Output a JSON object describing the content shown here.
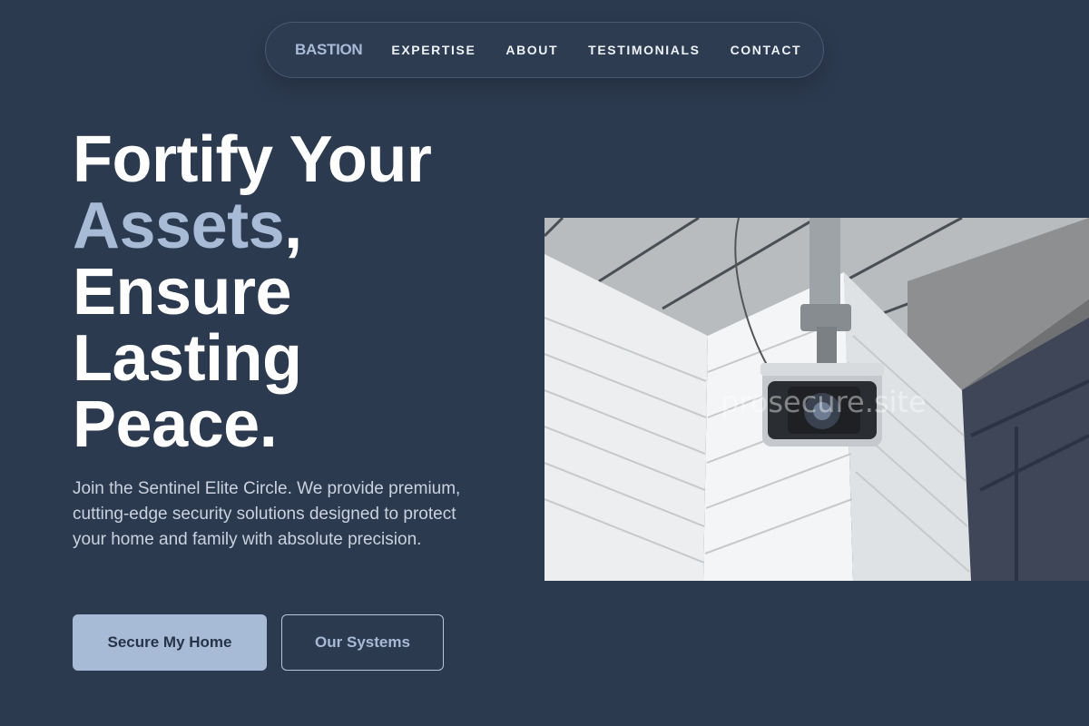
{
  "nav": {
    "brand": "BASTION",
    "links": [
      "EXPERTISE",
      "ABOUT",
      "TESTIMONIALS",
      "CONTACT"
    ]
  },
  "hero": {
    "headline": {
      "line1": "Fortify Your",
      "accent_word": "Assets",
      "accent_suffix": ",",
      "line3": "Ensure",
      "line4": "Lasting",
      "line5": "Peace."
    },
    "subtext": "Join the Sentinel Elite Circle. We provide premium, cutting-edge security solutions designed to protect your home and family with absolute precision.",
    "primary_button": "Secure My Home",
    "secondary_button": "Our Systems",
    "image_watermark": "prosecure.site"
  },
  "colors": {
    "background": "#2c3a4f",
    "accent": "#a7bad6",
    "text": "#ffffff"
  }
}
